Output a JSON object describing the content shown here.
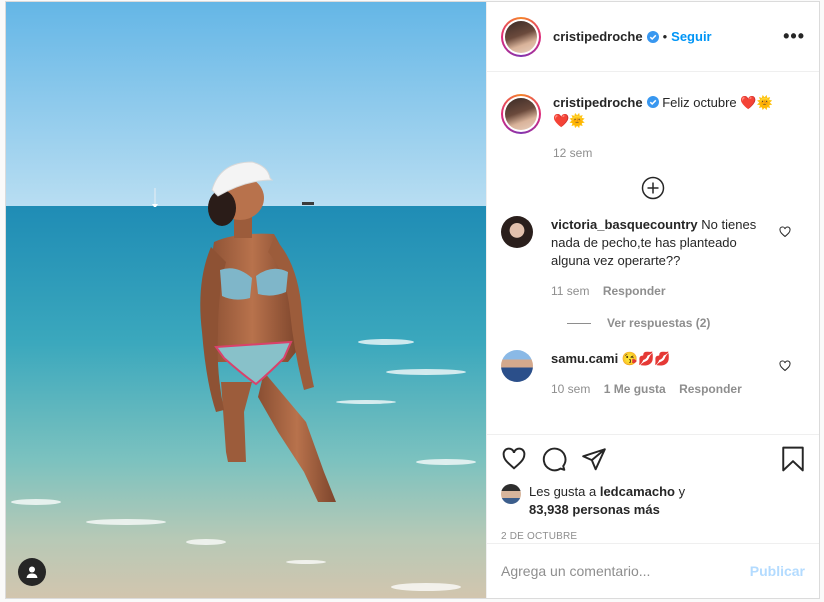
{
  "post": {
    "username": "cristipedroche",
    "follow_label": "Seguir",
    "separator": "•",
    "more_label": "•••"
  },
  "caption": {
    "username": "cristipedroche",
    "text": "Feliz octubre",
    "emoji_line1": "❤️🌞",
    "emoji_line2": "❤️🌞",
    "time": "12 sem"
  },
  "comments": [
    {
      "username": "victoria_basquecountry",
      "text": "No tienes nada de pecho,te has planteado alguna vez operarte??",
      "time": "11 sem",
      "reply_label": "Responder",
      "view_replies": "Ver respuestas (2)"
    },
    {
      "username": "samu.cami",
      "text": "😘💋💋",
      "time": "10 sem",
      "likes": "1 Me gusta",
      "reply_label": "Responder"
    }
  ],
  "likes": {
    "prefix": "Les gusta a",
    "user": "ledcamacho",
    "connector": "y",
    "others": "83,938 personas más"
  },
  "date": "2 DE OCTUBRE",
  "add_comment": {
    "placeholder": "Agrega un comentario...",
    "publish_label": "Publicar"
  },
  "colors": {
    "accent": "#0095f6",
    "publish_disabled": "#b3dbff",
    "muted": "#8e8e8e",
    "text": "#262626"
  },
  "icons": [
    "user-tag-icon",
    "verified-badge-icon",
    "more-options-icon",
    "plus-circle-icon",
    "heart-icon",
    "comment-icon",
    "share-icon",
    "save-icon"
  ]
}
